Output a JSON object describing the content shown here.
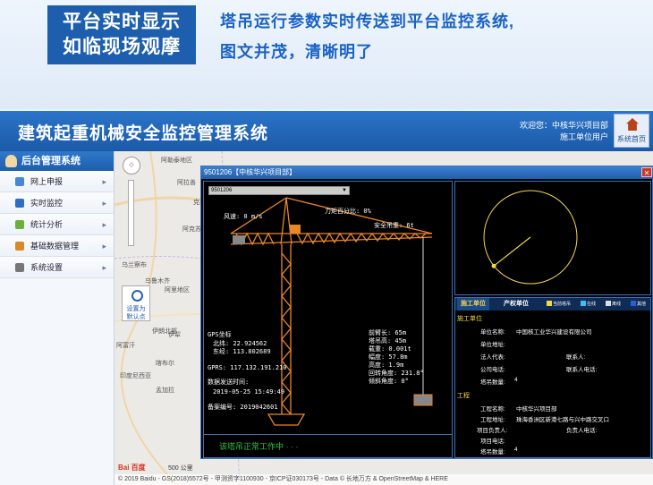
{
  "promo": {
    "box_line1": "平台实时显示",
    "box_line2": "如临现场观摩",
    "line1": "塔吊运行参数实时传送到平台监控系统,",
    "line2": "图文并茂，清晰明了"
  },
  "app": {
    "title": "建筑起重机械安全监控管理系统",
    "welcome": "欢迎您：中核华兴项目部",
    "user_role": "施工单位用户",
    "home_label": "系统首页"
  },
  "sidebar": {
    "header": "后台管理系统",
    "items": [
      {
        "label": "网上申报",
        "icon": "document-icon",
        "color": "#4a86d6"
      },
      {
        "label": "实时监控",
        "icon": "monitor-icon",
        "color": "#2d6ec2"
      },
      {
        "label": "统计分析",
        "icon": "chart-icon",
        "color": "#6bb23d"
      },
      {
        "label": "基础数据管理",
        "icon": "database-icon",
        "color": "#d68a2c"
      },
      {
        "label": "系统设置",
        "icon": "gear-icon",
        "color": "#777777"
      }
    ]
  },
  "map": {
    "labels": [
      "阿勒泰地区",
      "阿拉善",
      "克拉玛依",
      "阿拉善盟",
      "乌兰察布",
      "阿克苏",
      "阿里地区",
      "乌鲁木齐",
      "伊犁",
      "阿富汗",
      "伊朗北部",
      "喀布尔",
      "印度尼西亚",
      "孟加拉"
    ],
    "set_position": "设置为\n默认点",
    "scale": "500 公里",
    "baidu": "Bai 百度",
    "copyright": "© 2019 Baidu - GS(2018)5572号 - 甲测资字1100930 - 京ICP证030173号 - Data © 长地万方 & OpenStreetMap & HERE"
  },
  "dialog": {
    "title": "9501206【中核华兴项目部】",
    "close": "✕",
    "select_value": "9501206",
    "wind": "风速: 0 m/s",
    "moment": "力矩百分比: 0%",
    "safe_load": "安全吊重: 6t",
    "gps_title": "GPS坐标",
    "lat": "北纬: 22.924562",
    "lon": "东经: 113.802689",
    "gprs": "GPRS: 117.132.191.210",
    "send_time_label": "数据发送时间:",
    "send_time": "2019-05-25 15:49:49",
    "record_no": "备案编号: 2019042601",
    "jib_len": "前臂长: 65m",
    "tower_h": "塔吊高: 45m",
    "weight": "载重: 0.001t",
    "radius": "幅度: 57.8m",
    "height": "高度: 1.9m",
    "slew": "回转角度: 231.8°",
    "tilt": "倾斜角度: 0°",
    "status": "该塔吊正常工作中 · · ·"
  },
  "radar": {
    "slew_angle": 231.8
  },
  "info": {
    "tab_construction": "施工单位",
    "tab_property": "产权单位",
    "legend": [
      {
        "label": "当前塔吊",
        "color": "#f4d64d"
      },
      {
        "label": "在线",
        "color": "#3cc0f0"
      },
      {
        "label": "离线",
        "color": "#dddddd"
      },
      {
        "label": "其他",
        "color": "#2c5ccf"
      }
    ],
    "sec_construction": "施工单位",
    "unit_name_label": "单位名称:",
    "unit_name": "中国核工业华兴建设有限公司",
    "unit_address_label": "单位地址:",
    "legal_rep_label": "法人代表:",
    "contact_label": "联系人:",
    "company_phone_label": "公司电话:",
    "contact_phone_label": "联系人电话:",
    "crane_count_label": "塔吊数量:",
    "crane_count": "4",
    "sec_project": "工程",
    "project_name_label": "工程名称:",
    "project_name": "中核华兴项目部",
    "project_addr_label": "工程地址:",
    "project_addr": "珠海香洲区新港七路与兴中路交叉口",
    "project_lead_label": "项目负责人:",
    "lead_label": "负责人电话:",
    "project_phone_label": "项目电话:",
    "crane_count2_label": "塔吊数量:",
    "crane_count2": "4"
  }
}
